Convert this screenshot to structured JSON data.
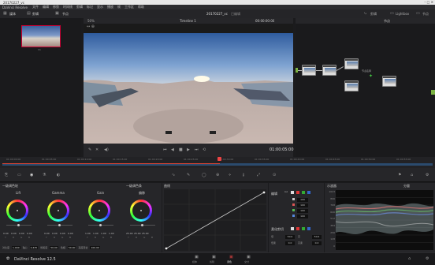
{
  "titlebar": {
    "title": "20170227_vc",
    "app_menu_label": "DaVinci Resolve"
  },
  "menu": {
    "items": [
      "文件",
      "编辑",
      "修剪",
      "时间线",
      "剪辑",
      "标记",
      "显示",
      "播放",
      "帧",
      "工作区",
      "帮助"
    ]
  },
  "toolbar": {
    "media_pool": "媒体",
    "clip_pool": "剪辑",
    "nodes_label": "节点",
    "lightbox": "Lightbox",
    "clips": "剪辑",
    "timeline_name": "Timeline 1",
    "timecode": "00:00:00:00",
    "project_title": "20170227_vc",
    "status": "已编辑"
  },
  "viewer": {
    "timecode": "01:00:05:00"
  },
  "nodes": {
    "labels": [
      "01",
      "02",
      "03",
      "04",
      "05"
    ],
    "node_caption": "节点名称"
  },
  "timeline": {
    "ticks": [
      "01:00:00:00",
      "01:00:05:00",
      "01:00:10:00",
      "01:00:15:00",
      "01:00:20:00",
      "01:00:25:00",
      "01:00:30:00",
      "01:00:35:00",
      "01:00:40:00",
      "01:00:45:00",
      "01:00:50:00",
      "01:00:55:00"
    ]
  },
  "wheels": {
    "header_left": "一级调色轮",
    "header_mode": "一级调色条",
    "labels": [
      "Lift",
      "Gamma",
      "Gain",
      "偏移"
    ],
    "values": [
      [
        "0.00",
        "0.00",
        "0.00",
        "0.00"
      ],
      [
        "0.00",
        "0.00",
        "0.00",
        "0.00"
      ],
      [
        "1.00",
        "1.00",
        "1.00",
        "1.00"
      ],
      [
        "25.00",
        "25.00",
        "25.00",
        ""
      ]
    ],
    "bottom": [
      "对比度",
      "1.000",
      "轴心",
      "0.435",
      "饱和度",
      "50.00",
      "色相",
      "50.00",
      "亮度混合",
      "100.00"
    ]
  },
  "curves": {
    "header": "曲线",
    "edit_label": "编辑",
    "values": [
      "100",
      "100",
      "100",
      "100"
    ],
    "soft_clip": "柔化剪切",
    "labels": [
      "低",
      "高",
      "低柔",
      "高柔"
    ],
    "numbers": [
      "50.0",
      "50.0",
      "0.0",
      "0.0"
    ]
  },
  "scopes": {
    "header": "示波器",
    "mode": "分量",
    "scale": [
      "1023",
      "896",
      "768",
      "640",
      "512",
      "384",
      "256",
      "128",
      "0"
    ]
  },
  "footer": {
    "app_name": "DaVinci Resolve 12.5",
    "pages": [
      "媒体",
      "剪辑",
      "调色",
      "交付"
    ],
    "active_page": "调色"
  },
  "colors": {
    "accent_red": "#c0392b",
    "accent_blue": "#4a90d9",
    "active_page": "#b83a3a"
  }
}
